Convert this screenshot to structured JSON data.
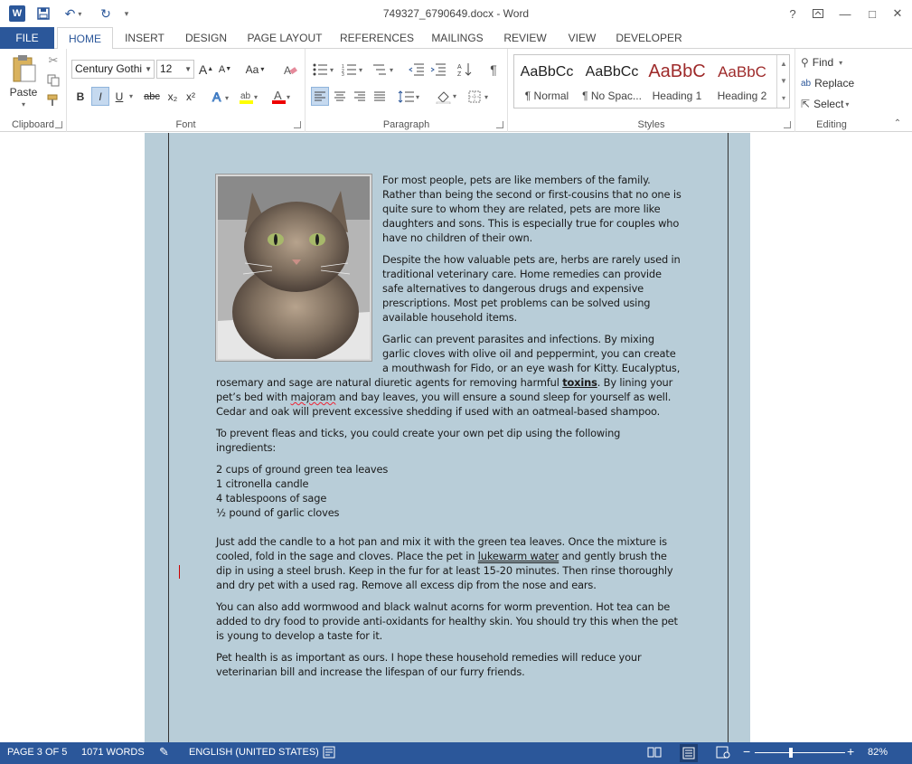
{
  "titlebar": {
    "doc_title": "749327_6790649.docx - Word",
    "help": "?",
    "minimize": "—",
    "restore": "□",
    "close": "✕"
  },
  "tabs": [
    "FILE",
    "HOME",
    "INSERT",
    "DESIGN",
    "PAGE LAYOUT",
    "REFERENCES",
    "MAILINGS",
    "REVIEW",
    "VIEW",
    "DEVELOPER"
  ],
  "ribbon": {
    "clipboard": {
      "label": "Clipboard",
      "paste": "Paste"
    },
    "font": {
      "label": "Font",
      "family": "Century Gothi",
      "size": "12",
      "bold": "B",
      "italic": "I",
      "underline": "U",
      "strike": "abc",
      "sub": "x₂",
      "sup": "x²",
      "grow": "A",
      "shrink": "A",
      "case": "Aa"
    },
    "paragraph": {
      "label": "Paragraph"
    },
    "styles": {
      "label": "Styles",
      "items": [
        {
          "sample": "AaBbCc",
          "name": "¶ Normal",
          "color": "#222222"
        },
        {
          "sample": "AaBbCc",
          "name": "¶ No Spac...",
          "color": "#222222"
        },
        {
          "sample": "AaBbC",
          "name": "Heading 1",
          "color": "#9e2a2a"
        },
        {
          "sample": "AaBbC",
          "name": "Heading 2",
          "color": "#9e2a2a"
        }
      ]
    },
    "editing": {
      "label": "Editing",
      "find": "Find",
      "replace": "Replace",
      "select": "Select"
    }
  },
  "document": {
    "p1": "For most people, pets are like members of the family. Rather than being the second or first-cousins that no one is quite sure to whom they are related, pets are more like daughters and sons. This is especially true for couples who have no children of their own.",
    "p2": "Despite the how valuable pets are, herbs are rarely used in traditional veterinary care. Home remedies can provide safe alternatives to dangerous drugs and expensive prescriptions. Most pet problems can be solved using available household items.",
    "p3a": "Garlic can prevent parasites and infections. By mixing garlic cloves with olive oil and peppermint, you can create a mouthwash for Fido, or an eye wash for Kitty. Eucalyptus, rosemary and sage are natural diuretic agents for removing harmful ",
    "p3_link": "toxins",
    "p3b": ". By lining your pet’s bed with ",
    "p3_misspelled": "majoram",
    "p3c": " and bay leaves, you will ensure a sound sleep for yourself as well. Cedar and oak will prevent excessive shedding if used with an oatmeal-based shampoo.",
    "p4": "To prevent fleas and ticks, you could create your own pet dip using the following ingredients:",
    "ingredients": [
      "2 cups of ground green tea leaves",
      "1 citronella candle",
      "4 tablespoons of sage",
      "½ pound of garlic cloves"
    ],
    "p5a": "Just add the candle to a hot pan and mix it with the green tea leaves. Once the mixture is cooled, fold in the sage and cloves. Place the pet in ",
    "p5_link": "lukewarm water",
    "p5b": " and gently brush the dip in using a steel brush. Keep in the fur for at least 15-20 minutes. Then rinse thoroughly and dry pet with a used rag. Remove all excess dip from the nose and ears.",
    "p6": "You can also add wormwood and black walnut acorns for worm prevention. Hot tea can be added to dry food to provide anti-oxidants for healthy skin. You should try this when the pet is young to develop a taste for it.",
    "p7": "Pet health is as important as ours. I hope these household remedies will reduce your veterinarian bill and increase the lifespan of our furry friends."
  },
  "status": {
    "page": "PAGE 3 OF 5",
    "words": "1071 WORDS",
    "language": "ENGLISH (UNITED STATES)",
    "zoom": "82%",
    "zoom_fraction": 0.82
  }
}
